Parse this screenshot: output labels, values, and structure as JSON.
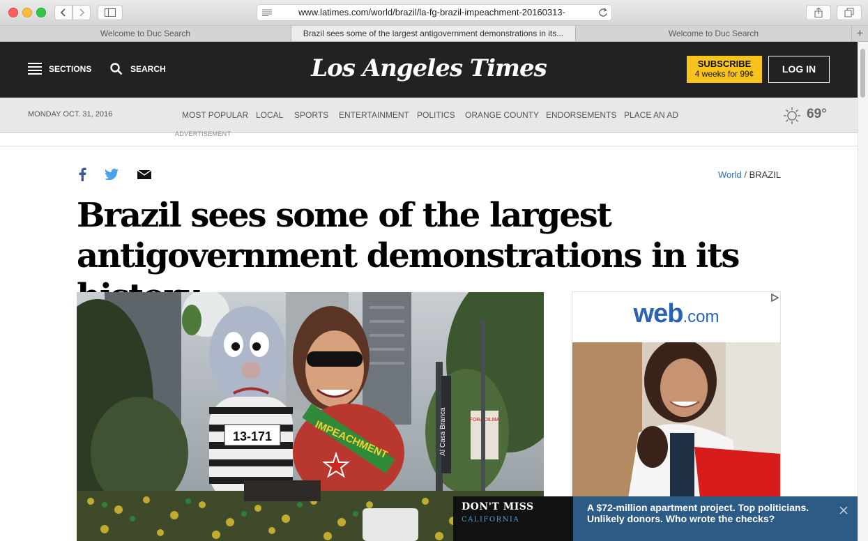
{
  "browser": {
    "url": "www.latimes.com/world/brazil/la-fg-brazil-impeachment-20160313-",
    "tabs": [
      {
        "label": "Welcome to Duc Search",
        "active": false
      },
      {
        "label": "Brazil sees some of the largest antigovernment demonstrations in its...",
        "active": true
      },
      {
        "label": "Welcome to Duc Search",
        "active": false
      }
    ]
  },
  "header": {
    "sections_label": "SECTIONS",
    "search_label": "SEARCH",
    "logo_text": "Los Angeles Times",
    "subscribe_label": "SUBSCRIBE",
    "subscribe_offer": "4 weeks for 99¢",
    "login_label": "LOG IN"
  },
  "nav": {
    "date": "MONDAY OCT. 31, 2016",
    "items": [
      "MOST POPULAR",
      "LOCAL",
      "SPORTS",
      "ENTERTAINMENT",
      "POLITICS",
      "ORANGE COUNTY",
      "ENDORSEMENTS",
      "PLACE AN AD"
    ],
    "weather_temp": "69°"
  },
  "ad_label": "ADVERTISEMENT",
  "article": {
    "breadcrumb_section": "World",
    "breadcrumb_separator": " / ",
    "breadcrumb_subsection": "BRAZIL",
    "headline": "Brazil sees some of the largest antigovernment demonstrations in its history",
    "photo": {
      "balloon_label_1": "13-171",
      "balloon_label_2": "IMPEACHMENT",
      "street_sign": "Al Casa Branca",
      "balloon_sign": "FORA DILMA"
    }
  },
  "sidebar_ad": {
    "brand": "web",
    "brand_suffix": ".com"
  },
  "dont_miss": {
    "title": "DON'T MISS",
    "category": "CALIFORNIA",
    "text": "A $72-million apartment project. Top politicians. Unlikely donors. Who wrote the checks?"
  },
  "colors": {
    "masthead": "#222222",
    "subscribe": "#f7c31c",
    "link_blue": "#2a6ebb",
    "dont_miss_panel": "#2c5b86"
  }
}
